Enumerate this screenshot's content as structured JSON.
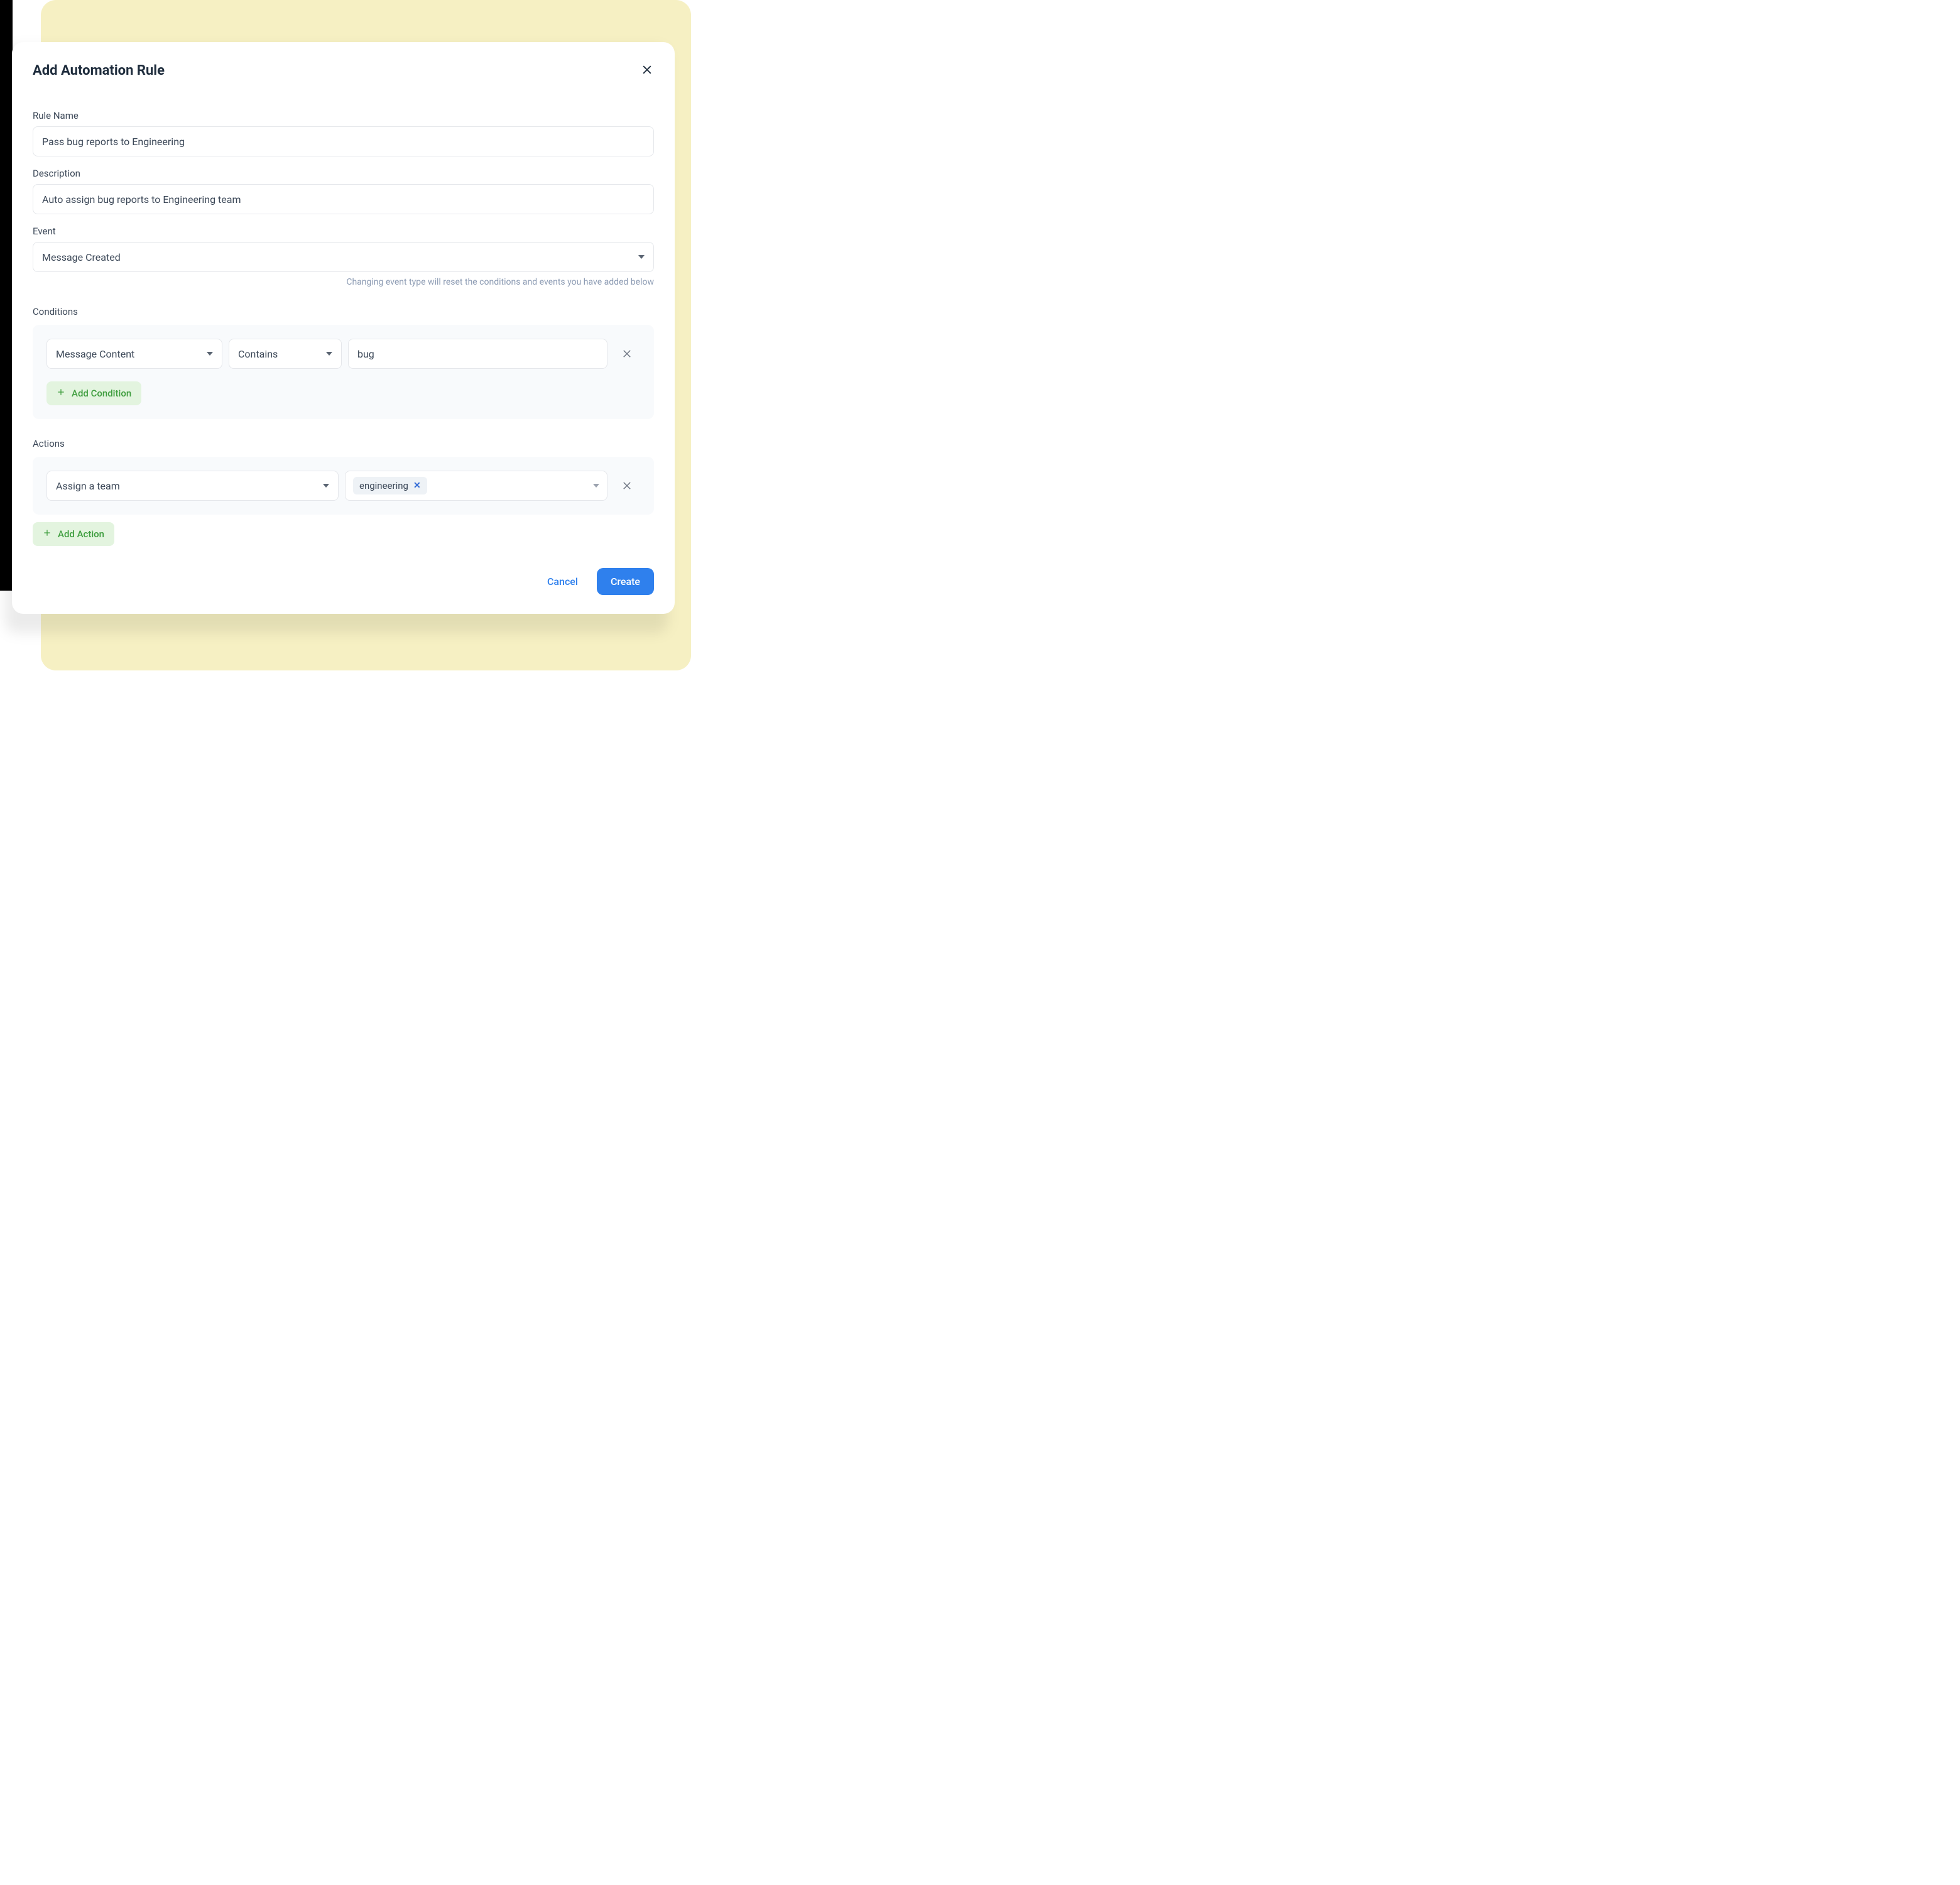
{
  "modal": {
    "title": "Add Automation Rule"
  },
  "fields": {
    "ruleName": {
      "label": "Rule Name",
      "value": "Pass bug reports to Engineering"
    },
    "description": {
      "label": "Description",
      "value": "Auto assign bug reports to Engineering team"
    },
    "event": {
      "label": "Event",
      "value": "Message Created",
      "helper": "Changing event type will reset the conditions and events you have added below"
    }
  },
  "conditions": {
    "label": "Conditions",
    "rows": [
      {
        "field": "Message Content",
        "operator": "Contains",
        "value": "bug"
      }
    ],
    "addLabel": "Add Condition"
  },
  "actions": {
    "label": "Actions",
    "rows": [
      {
        "action": "Assign a team",
        "tags": [
          "engineering"
        ]
      }
    ],
    "addLabel": "Add Action"
  },
  "footer": {
    "cancel": "Cancel",
    "create": "Create"
  }
}
